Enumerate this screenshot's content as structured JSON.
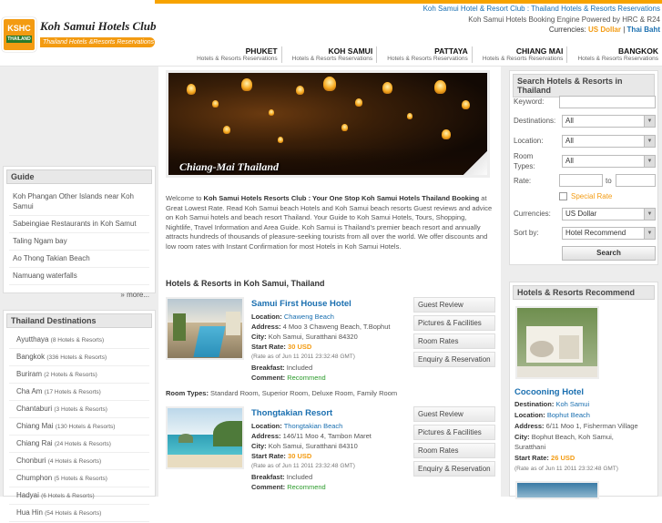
{
  "header": {
    "logo_badge": "KSHC",
    "logo_badge_sub": "THAILAND",
    "logo_title": "Koh Samui Hotels Club",
    "logo_tagline": "Thailand Hotels &Resorts Reservations",
    "top_links": "Koh Samui Hotel & Resort Club : Thailand Hotels & Resorts Reservations",
    "engine": "Koh Samui Hotels Booking Engine Powered by HRC & R24",
    "currency_label": "Currencies:",
    "currency_selected": "US Dollar",
    "currency_sep": "|",
    "currency_other": "Thai Baht"
  },
  "nav": [
    {
      "title": "PHUKET",
      "sub": "Hotels & Resorts Reservations"
    },
    {
      "title": "KOH SAMUI",
      "sub": "Hotels & Resorts Reservations"
    },
    {
      "title": "PATTAYA",
      "sub": "Hotels & Resorts Reservations"
    },
    {
      "title": "CHIANG MAI",
      "sub": "Hotels & Resorts Reservations"
    },
    {
      "title": "BANGKOK",
      "sub": "Hotels & Resorts Reservations"
    }
  ],
  "guide": {
    "title": "Guide",
    "items": [
      "Koh Phangan Other Islands near Koh Samui",
      "Sabeingiae Restaurants in Koh Samut",
      "Taling Ngam bay",
      "Ao Thong Takian Beach",
      "Namuang waterfalls"
    ],
    "more": "» more..."
  },
  "destinations": {
    "title": "Thailand Destinations",
    "items": [
      {
        "name": "Ayutthaya",
        "count": "(8 Hotels & Resorts)"
      },
      {
        "name": "Bangkok",
        "count": "(336 Hotels & Resorts)"
      },
      {
        "name": "Buriram",
        "count": "(2 Hotels & Resorts)"
      },
      {
        "name": "Cha Am",
        "count": "(17 Hotels & Resorts)"
      },
      {
        "name": "Chantaburi",
        "count": "(3 Hotels & Resorts)"
      },
      {
        "name": "Chiang Mai",
        "count": "(130 Hotels & Resorts)"
      },
      {
        "name": "Chiang Rai",
        "count": "(24 Hotels & Resorts)"
      },
      {
        "name": "Chonburi",
        "count": "(4 Hotels & Resorts)"
      },
      {
        "name": "Chumphon",
        "count": "(5 Hotels & Resorts)"
      },
      {
        "name": "Hadyai",
        "count": "(6 Hotels & Resorts)"
      },
      {
        "name": "Hua Hin",
        "count": "(54 Hotels & Resorts)"
      }
    ]
  },
  "banner": {
    "caption": "Chiang-Mai Thailand"
  },
  "welcome": {
    "lead": "Welcome to ",
    "bold": "Koh Samui Hotels Resorts Club : Your One Stop Koh Samui Hotels Thailand Booking",
    "text": " at Great Lowest Rate. Read Koh Samui beach Hotels and Koh Samui beach resorts Guest reviews and advice on Koh Samui hotels and beach resort Thailand. Your Guide to Koh Samui Hotels, Tours, Shopping, Nightlife, Travel Information and Area Guide. Koh Samui is Thailand's premier beach resort and annually attracts hundreds of thousands of pleasure-seeking tourists from all over the world. We offer discounts and low room rates with Instant Confirmation for most Hotels in Koh Samui Hotels."
  },
  "hotels_section_title": "Hotels & Resorts in Koh Samui, Thailand",
  "labels": {
    "location": "Location:",
    "address": "Address:",
    "city": "City:",
    "start_rate": "Start Rate:",
    "breakfast": "Breakfast:",
    "comment": "Comment:",
    "room_types": "Room Types:",
    "destination": "Destination:"
  },
  "hotels": [
    {
      "name": "Samui First House Hotel",
      "location": "Chaweng Beach",
      "address": "4 Moo 3 Chaweng Beach, T.Bophut",
      "city": "Koh Samui, Suratthani 84320",
      "rate": "30 USD",
      "rate_note": "(Rate as of Jun 11 2011 23:32:48 GMT)",
      "breakfast": "Included",
      "comment": "Recommend",
      "room_types": "Standard Room, Superior Room, Deluxe Room, Family Room",
      "buttons": [
        "Guest Review",
        "Pictures & Facilities",
        "Room Rates",
        "Enquiry & Reservation"
      ]
    },
    {
      "name": "Thongtakian Resort",
      "location": "Thongtakian Beach",
      "address": "146/11 Moo 4, Tambon Maret",
      "city": "Koh Samui, Suratthani 84310",
      "rate": "30 USD",
      "rate_note": "(Rate as of Jun 11 2011 23:32:48 GMT)",
      "breakfast": "Included",
      "comment": "Recommend",
      "buttons": [
        "Guest Review",
        "Pictures & Facilities",
        "Room Rates",
        "Enquiry & Reservation"
      ]
    }
  ],
  "search": {
    "title": "Search Hotels & Resorts in Thailand",
    "keyword_label": "Keyword:",
    "destinations_label": "Destinations:",
    "destinations_value": "All",
    "location_label": "Location:",
    "location_value": "All",
    "roomtypes_label": "Room Types:",
    "roomtypes_value": "All",
    "rate_label": "Rate:",
    "rate_to": "to",
    "special_rate": "Special Rate",
    "currencies_label": "Currencies:",
    "currencies_value": "US Dollar",
    "sortby_label": "Sort by:",
    "sortby_value": "Hotel Recommend",
    "button": "Search"
  },
  "recommend": {
    "title": "Hotels & Resorts Recommend",
    "name": "Cocooning Hotel",
    "destination": "Koh Samui",
    "location": "Bophut Beach",
    "address": "6/11 Moo 1, Fisherman Village",
    "city": "Bophut Beach, Koh Samui,",
    "city2": "Suratthani",
    "rate": "26 USD",
    "rate_note": "(Rate as of Jun 11 2011 23:32:48 GMT)"
  },
  "icons": {
    "dropdown": "dropdown-arrow-icon"
  },
  "colors": {
    "accent": "#f39b12",
    "link": "#1a6fb0",
    "bg": "#ededed"
  }
}
